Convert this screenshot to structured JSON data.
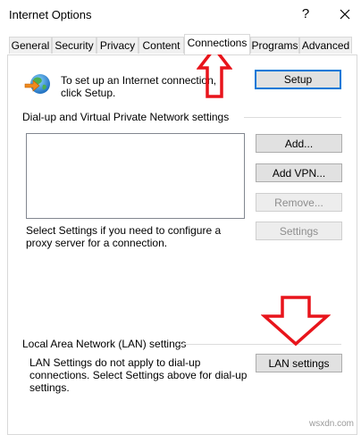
{
  "window": {
    "title": "Internet Options",
    "help_glyph": "?"
  },
  "tabs": [
    {
      "label": "General"
    },
    {
      "label": "Security"
    },
    {
      "label": "Privacy"
    },
    {
      "label": "Content"
    },
    {
      "label": "Connections",
      "active": true
    },
    {
      "label": "Programs"
    },
    {
      "label": "Advanced"
    }
  ],
  "setup": {
    "text": "To set up an Internet connection, click Setup.",
    "button_label": "Setup"
  },
  "dialup": {
    "group_label": "Dial-up and Virtual Private Network settings",
    "add_label": "Add...",
    "add_vpn_label": "Add VPN...",
    "remove_label": "Remove...",
    "proxy_text": "Select Settings if you need to configure a proxy server for a connection.",
    "settings_label": "Settings"
  },
  "lan": {
    "group_label": "Local Area Network (LAN) settings",
    "info_text": "LAN Settings do not apply to dial-up connections. Select Settings above for dial-up settings.",
    "button_label": "LAN settings"
  },
  "watermark": "wsxdn.com",
  "colors": {
    "annotation_arrow": "#e8141b",
    "default_button_border": "#0078d7",
    "panel_border": "#d9d9d9"
  },
  "icons": [
    "close-icon",
    "internet-globe-icon",
    "annotation-arrow-up",
    "annotation-arrow-down"
  ]
}
